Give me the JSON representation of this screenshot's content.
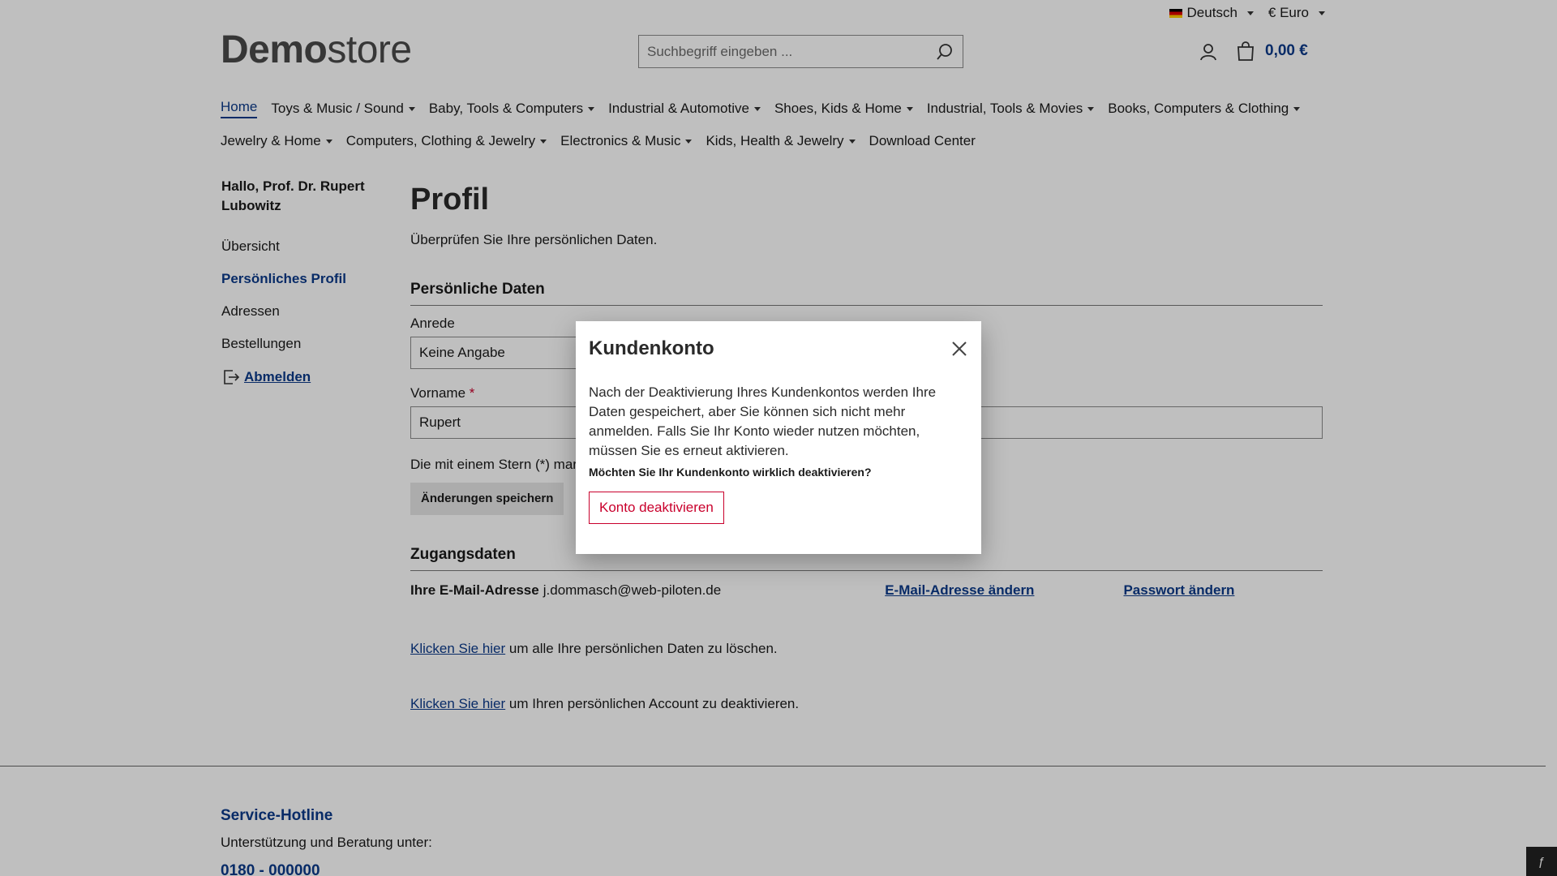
{
  "topbar": {
    "language": "Deutsch",
    "currency": "€ Euro"
  },
  "logo": {
    "bold": "Demo",
    "light": "store"
  },
  "search": {
    "placeholder": "Suchbegriff eingeben ..."
  },
  "cart": {
    "amount": "0,00 €"
  },
  "nav": {
    "items": [
      "Home",
      "Toys & Music / Sound",
      "Baby, Tools & Computers",
      "Industrial & Automotive",
      "Shoes, Kids & Home",
      "Industrial, Tools & Movies",
      "Books, Computers & Clothing",
      "Jewelry & Home",
      "Computers, Clothing & Jewelry",
      "Electronics & Music",
      "Kids, Health & Jewelry",
      "Download Center"
    ]
  },
  "sidebar": {
    "greeting": "Hallo, Prof. Dr. Rupert Lubowitz",
    "items": [
      "Übersicht",
      "Persönliches Profil",
      "Adressen",
      "Bestellungen"
    ],
    "logout": "Abmelden"
  },
  "main": {
    "title": "Profil",
    "lead": "Überprüfen Sie Ihre persönlichen Daten.",
    "personal_title": "Persönliche Daten",
    "salutation_label": "Anrede",
    "salutation_value": "Keine Angabe",
    "firstname_label": "Vorname",
    "required_star": "*",
    "firstname_value": "Rupert",
    "note": "Die mit einem Stern (*) mar",
    "save_label": "Änderungen speichern",
    "access_title": "Zugangsdaten",
    "email_label": "Ihre E-Mail-Adresse",
    "email_value": "j.dommasch@web-piloten.de",
    "change_email": "E-Mail-Adresse ändern",
    "change_password": "Passwort ändern",
    "delete_link": "Klicken Sie hier",
    "delete_text": "um alle Ihre persönlichen Daten zu löschen.",
    "deactivate_link": "Klicken Sie hier",
    "deactivate_text": "um Ihren persönlichen Account zu deaktivieren."
  },
  "footer": {
    "title": "Service-Hotline",
    "subtitle": "Unterstützung und Beratung unter:",
    "phone": "0180 - 000000"
  },
  "modal": {
    "title": "Kundenkonto",
    "body": "Nach der Deaktivierung Ihres Kundenkontos werden Ihre Daten gespeichert, aber Sie können sich nicht mehr anmelden. Falls Sie Ihr Konto wieder nutzen möchten, müssen Sie es erneut aktivieren.",
    "question": "Möchten Sie Ihr Kundenkonto wirklich deaktivieren?",
    "button": "Konto deaktivieren"
  },
  "colors": {
    "accent": "#0b3a8a",
    "danger": "#c9002c"
  }
}
